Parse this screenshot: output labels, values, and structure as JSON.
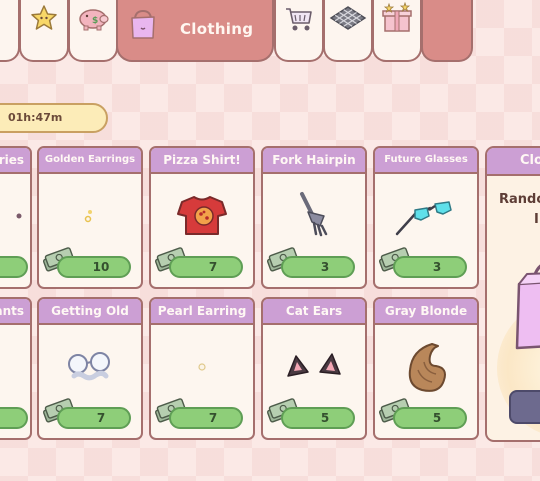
{
  "tabs": {
    "active_label": "Clothing",
    "icons": [
      "star-icon",
      "piggy-bank-icon",
      "shopping-bag-icon",
      "shopping-cart-icon",
      "floor-tile-icon",
      "gift-box-icon"
    ]
  },
  "timer": {
    "text": "01h:47m"
  },
  "row1": [
    {
      "name": "ries",
      "price": ""
    },
    {
      "name": "Golden Earrings",
      "price": "10"
    },
    {
      "name": "Pizza Shirt!",
      "price": "7"
    },
    {
      "name": "Fork Hairpin",
      "price": "3"
    },
    {
      "name": "Future Glasses",
      "price": "3"
    }
  ],
  "row2": [
    {
      "name": "ants",
      "price": ""
    },
    {
      "name": "Getting Old",
      "price": "7"
    },
    {
      "name": "Pearl Earring",
      "price": "7"
    },
    {
      "name": "Cat Ears",
      "price": "5"
    },
    {
      "name": "Gray Blonde",
      "price": "5"
    }
  ],
  "promo": {
    "title": "Clo",
    "line1": "Rando",
    "line2": "I"
  },
  "colors": {
    "header": "#cc9fd4",
    "price_fill": "#8ece79",
    "tab_active": "#d98c88",
    "border": "#a56f6d"
  }
}
